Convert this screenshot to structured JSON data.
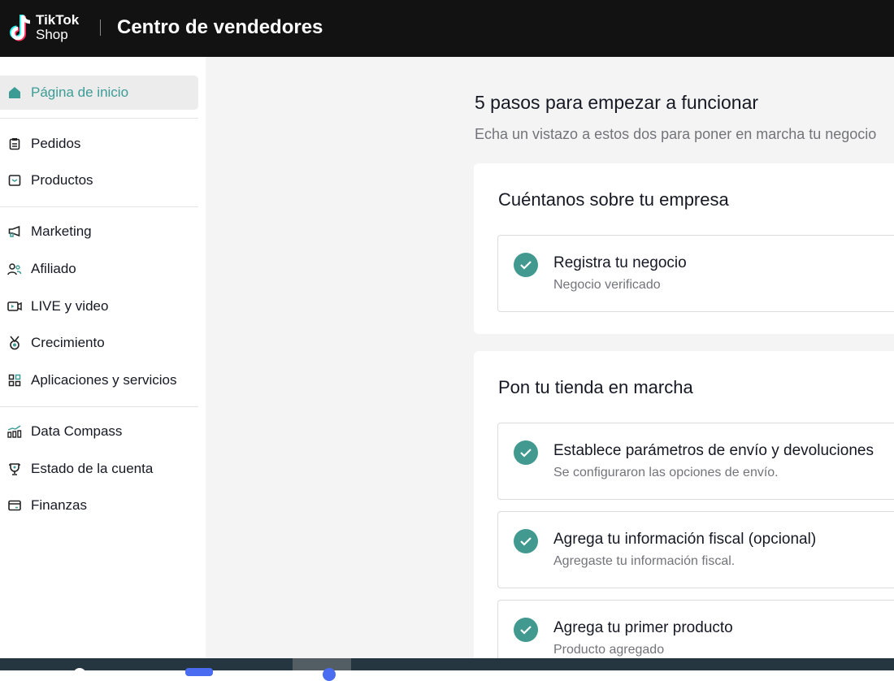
{
  "header": {
    "logo_line1": "TikTok",
    "logo_line2": "Shop",
    "title": "Centro de vendedores"
  },
  "sidebar": {
    "items": [
      {
        "label": "Página de inicio",
        "icon": "home-icon"
      },
      {
        "label": "Pedidos",
        "icon": "clipboard-icon"
      },
      {
        "label": "Productos",
        "icon": "box-icon"
      },
      {
        "label": "Marketing",
        "icon": "megaphone-icon"
      },
      {
        "label": "Afiliado",
        "icon": "users-icon"
      },
      {
        "label": "LIVE y video",
        "icon": "video-icon"
      },
      {
        "label": "Crecimiento",
        "icon": "medal-icon"
      },
      {
        "label": "Aplicaciones y servicios",
        "icon": "apps-icon"
      },
      {
        "label": "Data Compass",
        "icon": "chart-icon"
      },
      {
        "label": "Estado de la cuenta",
        "icon": "trophy-icon"
      },
      {
        "label": "Finanzas",
        "icon": "wallet-icon"
      }
    ]
  },
  "main": {
    "title": "5 pasos para empezar a funcionar",
    "subtitle": "Echa un vistazo a estos dos para poner en marcha tu negocio",
    "cards": [
      {
        "title": "Cuéntanos sobre tu empresa",
        "steps": [
          {
            "title": "Registra tu negocio",
            "desc": "Negocio verificado"
          }
        ]
      },
      {
        "title": "Pon tu tienda en marcha",
        "steps": [
          {
            "title": "Establece parámetros de envío y devoluciones",
            "desc": "Se configuraron las opciones de envío."
          },
          {
            "title": "Agrega tu información fiscal (opcional)",
            "desc": "Agregaste tu información fiscal."
          },
          {
            "title": "Agrega tu primer producto",
            "desc": "Producto agregado"
          }
        ]
      }
    ]
  },
  "colors": {
    "accent": "#41998f",
    "header_bg": "#121212",
    "taskbar": "#263640"
  }
}
